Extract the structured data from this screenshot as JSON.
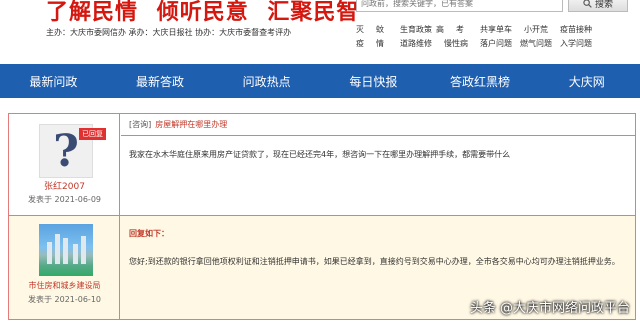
{
  "header": {
    "slogan": [
      "了解民情",
      "倾听民意",
      "汇聚民智"
    ],
    "orgs": "主办：大庆市委网信办   承办：大庆日报社   协办：大庆市委督查考评办"
  },
  "search": {
    "placeholder": "问政前，搜索关键字，已有答案",
    "button_label": "搜索"
  },
  "categories": [
    [
      "灭",
      "蚊",
      "生育政策",
      "高",
      "考",
      "共享单车",
      "小开荒",
      "疫苗接种"
    ],
    [
      "疫",
      "情",
      "道路维修",
      "慢性病",
      "落户问题",
      "燃气问题",
      "入学问题"
    ]
  ],
  "nav": [
    "最新问政",
    "最新答政",
    "问政热点",
    "每日快报",
    "答政红黑榜",
    "大庆网"
  ],
  "question": {
    "badge": "已回复",
    "username": "张红2007",
    "date": "发表于 2021-06-09",
    "tag": "[咨询]",
    "title": "房屋解押在哪里办理",
    "body": "我家在水木华庭住原来用房产证贷款了，现在已经还完4年，想咨询一下在哪里办理解押手续，都需要带什么"
  },
  "answer": {
    "username": "市住房和城乡建设局",
    "date": "发表于 2021-06-10",
    "heading": "回复如下：",
    "body": "您好;到还款的银行拿回他项权利证和注销抵押申请书，如果已经拿到，直接约号到交易中心办理，全市各交易中心均可办理注销抵押业务。"
  },
  "watermark": "头条 @大庆市网络问政平台"
}
